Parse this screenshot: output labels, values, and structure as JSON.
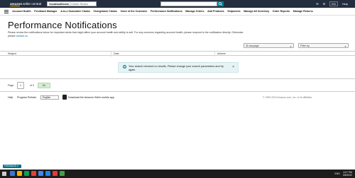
{
  "header": {
    "logo_brand": "amazon",
    "logo_text": "seller central",
    "store_name": "VocaliastDeals",
    "marketplace": "United States",
    "search_placeholder": "Search",
    "language": "EN",
    "help_label": "Help"
  },
  "nav": {
    "items": [
      "Account Health",
      "Feedback Manager",
      "A-to-z Guarantee Claims",
      "Chargeback Claims",
      "Voice of the Customer",
      "Performance Notifications",
      "Manage Orders",
      "Add Products",
      "Shipments",
      "Manage All Inventory",
      "Order Reports",
      "Manage Returns"
    ]
  },
  "page": {
    "title": "Performance Notifications",
    "description": "Please review the notifications below for important alerts that might affect your account health and ability to sell. For any concerns regarding account health, please respond to the notification directly. Otherwise please",
    "contact_link": "contact us",
    "contact_suffix": "."
  },
  "filters": {
    "date_range": "30 ascpage",
    "filter_by": "Filter by"
  },
  "table": {
    "columns": [
      "Subject",
      "Date",
      "Actions"
    ]
  },
  "alert": {
    "message": "Your search returned no results. Please change your search parameters and try again.",
    "close": "×"
  },
  "pager": {
    "label": "Page",
    "current": "1",
    "of": "of 0",
    "go": "Go"
  },
  "footer": {
    "help": "Help",
    "policies": "Program Policies",
    "language": "English",
    "app": "Download the Amazon Seller mobile app",
    "copyright": "© 1999-2022 Amazon.com, Inc. or its affiliates"
  },
  "feedback": "FEEDBACK ▾",
  "taskbar": {
    "time": "4:07 PM",
    "date": "3/8/2022",
    "lang": "ENG",
    "icon_colors": [
      "#3b78d6",
      "#f4b400",
      "#0f9d58",
      "#db4437",
      "#4285f4",
      "#1e88e5",
      "#e53935",
      "#43a047"
    ]
  }
}
